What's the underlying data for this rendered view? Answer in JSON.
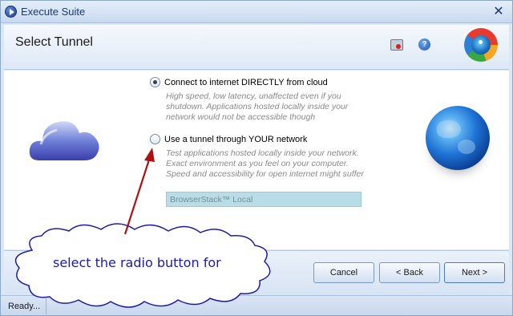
{
  "window": {
    "title": "Execute Suite",
    "close_glyph": "✕"
  },
  "header": {
    "page_title": "Select Tunnel",
    "help_glyph": "?",
    "icons": [
      "record-icon",
      "help-icon",
      "browserstack-logo"
    ]
  },
  "options": [
    {
      "label": "Connect to internet DIRECTLY from cloud",
      "checked": true,
      "description": "High speed, low latency, unaffected even if you shutdown. Applications hosted locally inside your network would not be accessible though"
    },
    {
      "label": "Use a tunnel through YOUR network",
      "checked": false,
      "description": "Test applications hosted locally inside your network. Exact environment as you feel on your computer. Speed and accessibility for open internet might suffer"
    }
  ],
  "tunnel_field": {
    "value": "BrowserStack™ Local"
  },
  "buttons": {
    "cancel": "Cancel",
    "back": "< Back",
    "next": "Next >"
  },
  "status": {
    "text": "Ready..."
  },
  "annotation": {
    "callout": "select the radio button for",
    "arrow_color": "#b01010",
    "text_color": "#1c1ca8"
  }
}
